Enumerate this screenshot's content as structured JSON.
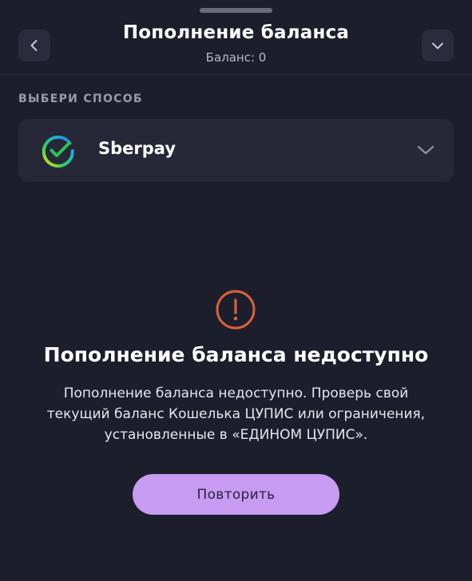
{
  "header": {
    "title": "Пополнение баланса",
    "subtitle": "Баланс: 0",
    "back_icon": "chevron-left-icon",
    "collapse_icon": "chevron-down-icon"
  },
  "payment": {
    "section_label": "ВЫБЕРИ СПОСОБ",
    "selected_method": "Sberpay",
    "method_icon": "sberpay-logo-icon",
    "dropdown_icon": "chevron-down-icon"
  },
  "error": {
    "icon": "exclamation-circle-icon",
    "title": "Пополнение баланса недоступно",
    "message": "Пополнение баланса недоступно. Проверь свой текущий баланс Кошелька ЦУПИС или ограничения, установленные в «ЕДИНОМ ЦУПИС».",
    "retry_label": "Повторить"
  },
  "colors": {
    "background": "#1d1e2c",
    "card": "#262838",
    "accent_button": "#c79bf2",
    "error_icon": "#d9623a"
  }
}
